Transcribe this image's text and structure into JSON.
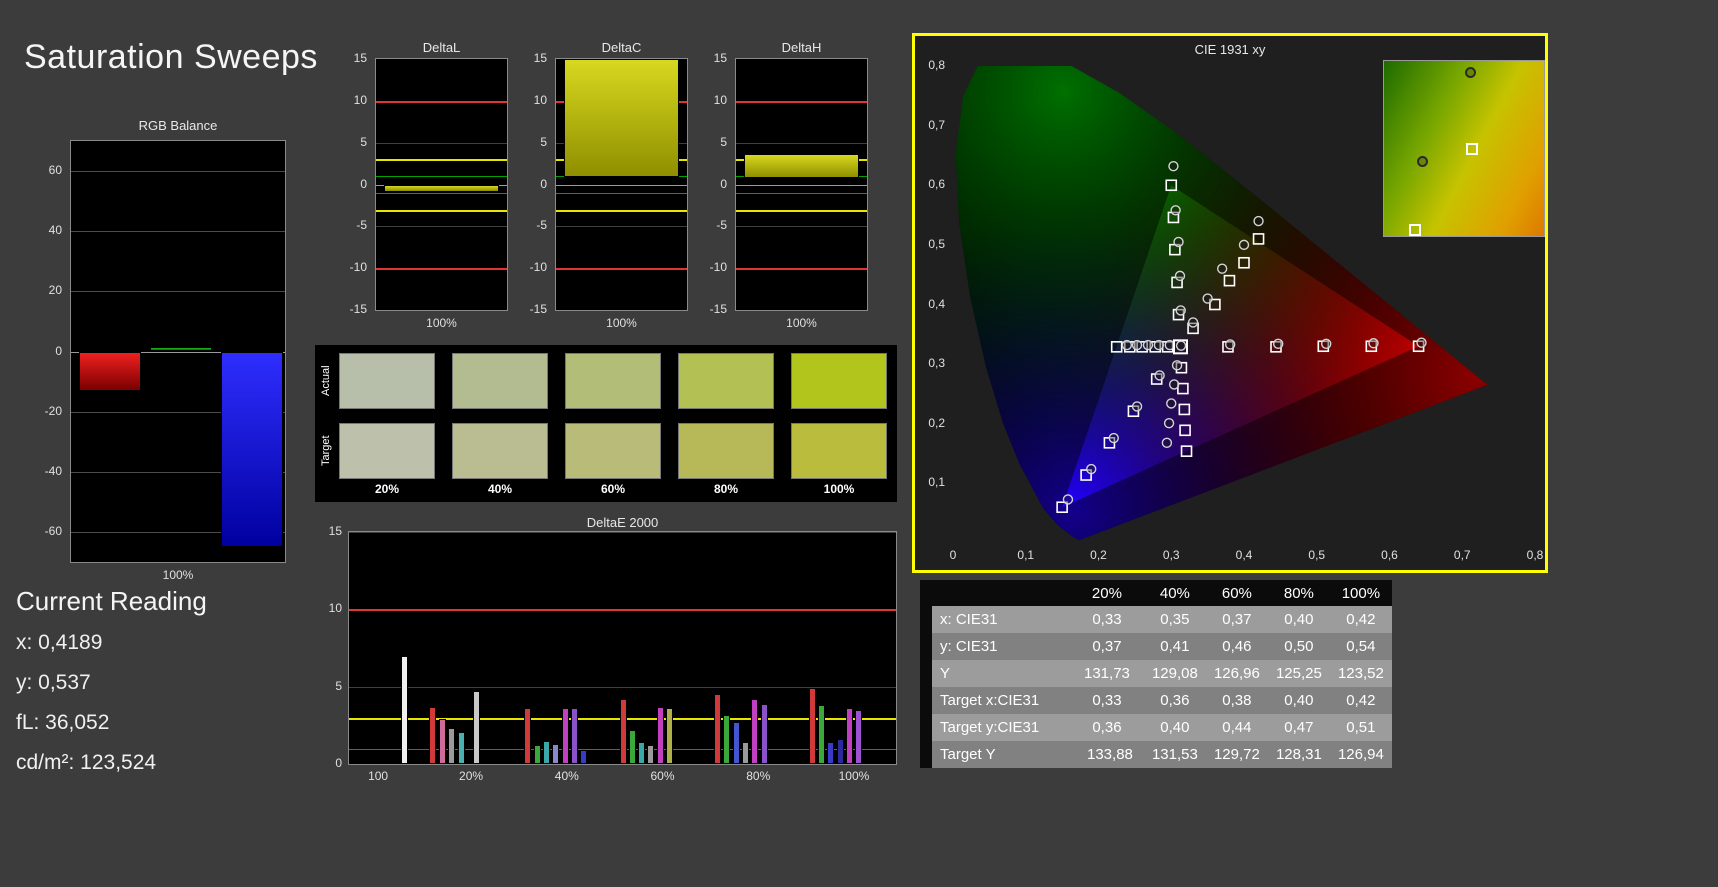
{
  "page": {
    "title": "Saturation Sweeps"
  },
  "current_reading": {
    "heading": "Current Reading",
    "x": "x: 0,4189",
    "y": "y: 0,537",
    "fl": "fL: 36,052",
    "cd": "cd/m²: 123,524"
  },
  "swatches": {
    "row_labels": [
      "Actual",
      "Target"
    ],
    "col_labels": [
      "20%",
      "40%",
      "60%",
      "80%",
      "100%"
    ],
    "actual": [
      "#b7bfaa",
      "#b3bc90",
      "#b2bd78",
      "#b3c054",
      "#b2c51d"
    ],
    "target": [
      "#bdc1ac",
      "#babd92",
      "#b9bc79",
      "#b7b959",
      "#babc3e"
    ]
  },
  "table": {
    "headers": [
      "",
      "20%",
      "40%",
      "60%",
      "80%",
      "100%"
    ],
    "rows": [
      {
        "label": "x: CIE31",
        "values": [
          "0,33",
          "0,35",
          "0,37",
          "0,40",
          "0,42"
        ]
      },
      {
        "label": "y: CIE31",
        "values": [
          "0,37",
          "0,41",
          "0,46",
          "0,50",
          "0,54"
        ]
      },
      {
        "label": "Y",
        "values": [
          "131,73",
          "129,08",
          "126,96",
          "125,25",
          "123,52"
        ]
      },
      {
        "label": "Target x:CIE31",
        "values": [
          "0,33",
          "0,36",
          "0,38",
          "0,40",
          "0,42"
        ]
      },
      {
        "label": "Target y:CIE31",
        "values": [
          "0,36",
          "0,40",
          "0,44",
          "0,47",
          "0,51"
        ]
      },
      {
        "label": "Target Y",
        "values": [
          "133,88",
          "131,53",
          "129,72",
          "128,31",
          "126,94"
        ]
      }
    ]
  },
  "chart_data": {
    "rgb_balance": {
      "type": "bar",
      "title": "RGB Balance",
      "xlabel": "100%",
      "ylim": [
        -70,
        70
      ],
      "yticks": [
        60,
        40,
        20,
        0,
        -20,
        -40,
        -60
      ],
      "bars": [
        {
          "name": "red",
          "value": -13,
          "color_top": "#f02020",
          "color_bottom": "#7a0000"
        },
        {
          "name": "green",
          "value": 1.5,
          "color_top": "#20c020",
          "color_bottom": "#007000"
        },
        {
          "name": "blue",
          "value": -65,
          "color_top": "#2e2eff",
          "color_bottom": "#0000a0"
        }
      ]
    },
    "delta_axis": {
      "ylim": [
        -15,
        15
      ],
      "yticks": [
        15,
        10,
        5,
        0,
        -5,
        -10,
        -15
      ],
      "limit_lines": {
        "red": 10,
        "yellow": 3,
        "green": 1
      },
      "bar_color_top": "#d8d820",
      "bar_color_bottom": "#8f8f00"
    },
    "delta_charts": [
      {
        "type": "bar",
        "title": "DeltaL",
        "xlabel": "100%",
        "bar_from": -0.9,
        "bar_to": 0
      },
      {
        "type": "bar",
        "title": "DeltaC",
        "xlabel": "100%",
        "bar_from": 0.9,
        "bar_to": 15
      },
      {
        "type": "bar",
        "title": "DeltaH",
        "xlabel": "100%",
        "bar_from": 0.8,
        "bar_to": 3.7
      }
    ],
    "deltae": {
      "type": "bar",
      "title": "DeltaE 2000",
      "ylim": [
        0,
        15
      ],
      "yticks": [
        15,
        10,
        5,
        0
      ],
      "limit_lines": {
        "red": 10,
        "yellow": 3,
        "green": 1
      },
      "xticks": [
        {
          "label": "100",
          "f": 0.055
        },
        {
          "label": "20%",
          "f": 0.225
        },
        {
          "label": "40%",
          "f": 0.4
        },
        {
          "label": "60%",
          "f": 0.575
        },
        {
          "label": "80%",
          "f": 0.75
        },
        {
          "label": "100%",
          "f": 0.925
        }
      ],
      "bars": [
        {
          "f": 0.1,
          "v": 7.0,
          "c": "#f0f0f0"
        },
        {
          "f": 0.152,
          "v": 3.7,
          "c": "#d03a3a"
        },
        {
          "f": 0.17,
          "v": 2.9,
          "c": "#d06a9a"
        },
        {
          "f": 0.187,
          "v": 2.3,
          "c": "#9a9a9a"
        },
        {
          "f": 0.204,
          "v": 2.1,
          "c": "#4ab0b0"
        },
        {
          "f": 0.232,
          "v": 4.7,
          "c": "#c8c8c8"
        },
        {
          "f": 0.325,
          "v": 3.6,
          "c": "#d03a3a"
        },
        {
          "f": 0.343,
          "v": 1.2,
          "c": "#3aa83a"
        },
        {
          "f": 0.36,
          "v": 1.5,
          "c": "#3aa8a8"
        },
        {
          "f": 0.377,
          "v": 1.3,
          "c": "#8888cc"
        },
        {
          "f": 0.394,
          "v": 3.6,
          "c": "#c040c0"
        },
        {
          "f": 0.411,
          "v": 3.6,
          "c": "#8a52c8"
        },
        {
          "f": 0.428,
          "v": 0.9,
          "c": "#3a3ac8"
        },
        {
          "f": 0.5,
          "v": 4.2,
          "c": "#d03a3a"
        },
        {
          "f": 0.517,
          "v": 2.2,
          "c": "#3aa83a"
        },
        {
          "f": 0.534,
          "v": 1.4,
          "c": "#3aa8a8"
        },
        {
          "f": 0.551,
          "v": 1.2,
          "c": "#9a9a9a"
        },
        {
          "f": 0.568,
          "v": 3.7,
          "c": "#c040c0"
        },
        {
          "f": 0.585,
          "v": 3.6,
          "c": "#b0b048"
        },
        {
          "f": 0.673,
          "v": 4.5,
          "c": "#d03a3a"
        },
        {
          "f": 0.69,
          "v": 3.2,
          "c": "#3aa83a"
        },
        {
          "f": 0.707,
          "v": 2.7,
          "c": "#4455d0"
        },
        {
          "f": 0.724,
          "v": 1.4,
          "c": "#9a9a9a"
        },
        {
          "f": 0.741,
          "v": 4.2,
          "c": "#c040c0"
        },
        {
          "f": 0.758,
          "v": 3.9,
          "c": "#8a52c8"
        },
        {
          "f": 0.846,
          "v": 4.9,
          "c": "#d03a3a"
        },
        {
          "f": 0.863,
          "v": 3.8,
          "c": "#3aa83a"
        },
        {
          "f": 0.88,
          "v": 1.4,
          "c": "#3a3ac8"
        },
        {
          "f": 0.897,
          "v": 1.6,
          "c": "#2a2a9a"
        },
        {
          "f": 0.914,
          "v": 3.6,
          "c": "#c040c0"
        },
        {
          "f": 0.931,
          "v": 3.5,
          "c": "#9a52d0"
        }
      ]
    },
    "cie": {
      "type": "scatter",
      "title": "CIE 1931 xy",
      "xlim": [
        0,
        0.8
      ],
      "ylim": [
        0,
        0.8
      ],
      "xtick_labels": [
        "0",
        "0,1",
        "0,2",
        "0,3",
        "0,4",
        "0,5",
        "0,6",
        "0,7",
        "0,8"
      ],
      "ytick_labels": [
        "0,8",
        "0,7",
        "0,6",
        "0,5",
        "0,4",
        "0,3",
        "0,2",
        "0,1"
      ],
      "gamut_triangle": [
        [
          0.64,
          0.33
        ],
        [
          0.3,
          0.6
        ],
        [
          0.15,
          0.06
        ]
      ],
      "white_point_target": [
        0.3127,
        0.329
      ],
      "white_point_measured": [
        0.3135,
        0.331
      ],
      "target_points": [
        [
          0.378,
          0.329
        ],
        [
          0.444,
          0.329
        ],
        [
          0.509,
          0.33
        ],
        [
          0.575,
          0.33
        ],
        [
          0.64,
          0.33
        ],
        [
          0.31,
          0.383
        ],
        [
          0.308,
          0.437
        ],
        [
          0.305,
          0.492
        ],
        [
          0.303,
          0.546
        ],
        [
          0.3,
          0.6
        ],
        [
          0.28,
          0.275
        ],
        [
          0.248,
          0.221
        ],
        [
          0.215,
          0.168
        ],
        [
          0.183,
          0.114
        ],
        [
          0.15,
          0.06
        ],
        [
          0.295,
          0.329
        ],
        [
          0.278,
          0.329
        ],
        [
          0.26,
          0.329
        ],
        [
          0.243,
          0.329
        ],
        [
          0.225,
          0.329
        ],
        [
          0.314,
          0.294
        ],
        [
          0.316,
          0.259
        ],
        [
          0.318,
          0.224
        ],
        [
          0.319,
          0.189
        ],
        [
          0.321,
          0.154
        ],
        [
          0.33,
          0.36
        ],
        [
          0.36,
          0.4
        ],
        [
          0.38,
          0.44
        ],
        [
          0.4,
          0.47
        ],
        [
          0.42,
          0.51
        ]
      ],
      "measured_points": [
        [
          0.381,
          0.333
        ],
        [
          0.447,
          0.334
        ],
        [
          0.513,
          0.334
        ],
        [
          0.578,
          0.335
        ],
        [
          0.644,
          0.336
        ],
        [
          0.313,
          0.39
        ],
        [
          0.312,
          0.448
        ],
        [
          0.31,
          0.505
        ],
        [
          0.306,
          0.558
        ],
        [
          0.303,
          0.632
        ],
        [
          0.284,
          0.281
        ],
        [
          0.253,
          0.229
        ],
        [
          0.221,
          0.176
        ],
        [
          0.19,
          0.124
        ],
        [
          0.158,
          0.073
        ],
        [
          0.298,
          0.332
        ],
        [
          0.283,
          0.332
        ],
        [
          0.268,
          0.332
        ],
        [
          0.253,
          0.332
        ],
        [
          0.239,
          0.332
        ],
        [
          0.308,
          0.298
        ],
        [
          0.304,
          0.266
        ],
        [
          0.3,
          0.234
        ],
        [
          0.297,
          0.201
        ],
        [
          0.294,
          0.168
        ],
        [
          0.33,
          0.37
        ],
        [
          0.35,
          0.41
        ],
        [
          0.37,
          0.46
        ],
        [
          0.4,
          0.5
        ],
        [
          0.42,
          0.54
        ]
      ],
      "inset": {
        "points": [
          {
            "type": "measured",
            "x": 0.54,
            "y": 0.07
          },
          {
            "type": "measured",
            "x": 0.24,
            "y": 0.57
          },
          {
            "type": "target",
            "x": 0.55,
            "y": 0.5
          },
          {
            "type": "target",
            "x": 0.2,
            "y": 0.96
          }
        ]
      }
    }
  }
}
